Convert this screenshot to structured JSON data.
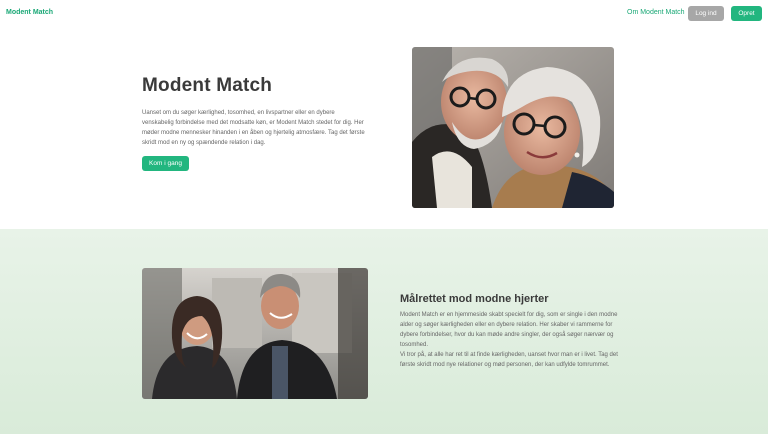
{
  "navbar": {
    "brand": "Modent Match",
    "about_label": "Om Modent Match",
    "login_label": "Log ind",
    "create_label": "Opret"
  },
  "hero": {
    "title": "Modent Match",
    "text": "Uanset om du søger kærlighed, tosomhed, en livspartner eller en dybere venskabelig forbindelse med det modsatte køn, er Modent Match stedet for dig. Her møder modne mennesker hinanden i en åben og hjertelig atmosfære. Tag det første skridt mod en ny og spændende relation i dag.",
    "cta_label": "Kom i gang"
  },
  "about": {
    "title": "Målrettet mod modne hjerter",
    "paragraph1": "Modent Match er en hjemmeside skabt specielt for dig, som er single i den modne alder og søger kærligheden eller en dybere relation. Her skaber vi rammerne for dybere forbindelser, hvor du kan møde andre singler, der også søger nærvær og tosomhed.",
    "paragraph2": "Vi tror på, at alle har ret til at finde kærligheden, uanset hvor man er i livet. Tag det første skridt mod nye relationer og mød personen, der kan udfylde tomrummet."
  },
  "colors": {
    "accent": "#22b67f",
    "brand_text": "#1aa876",
    "login_button": "#a7a7a7",
    "section_bg": "#e3f0e3"
  }
}
